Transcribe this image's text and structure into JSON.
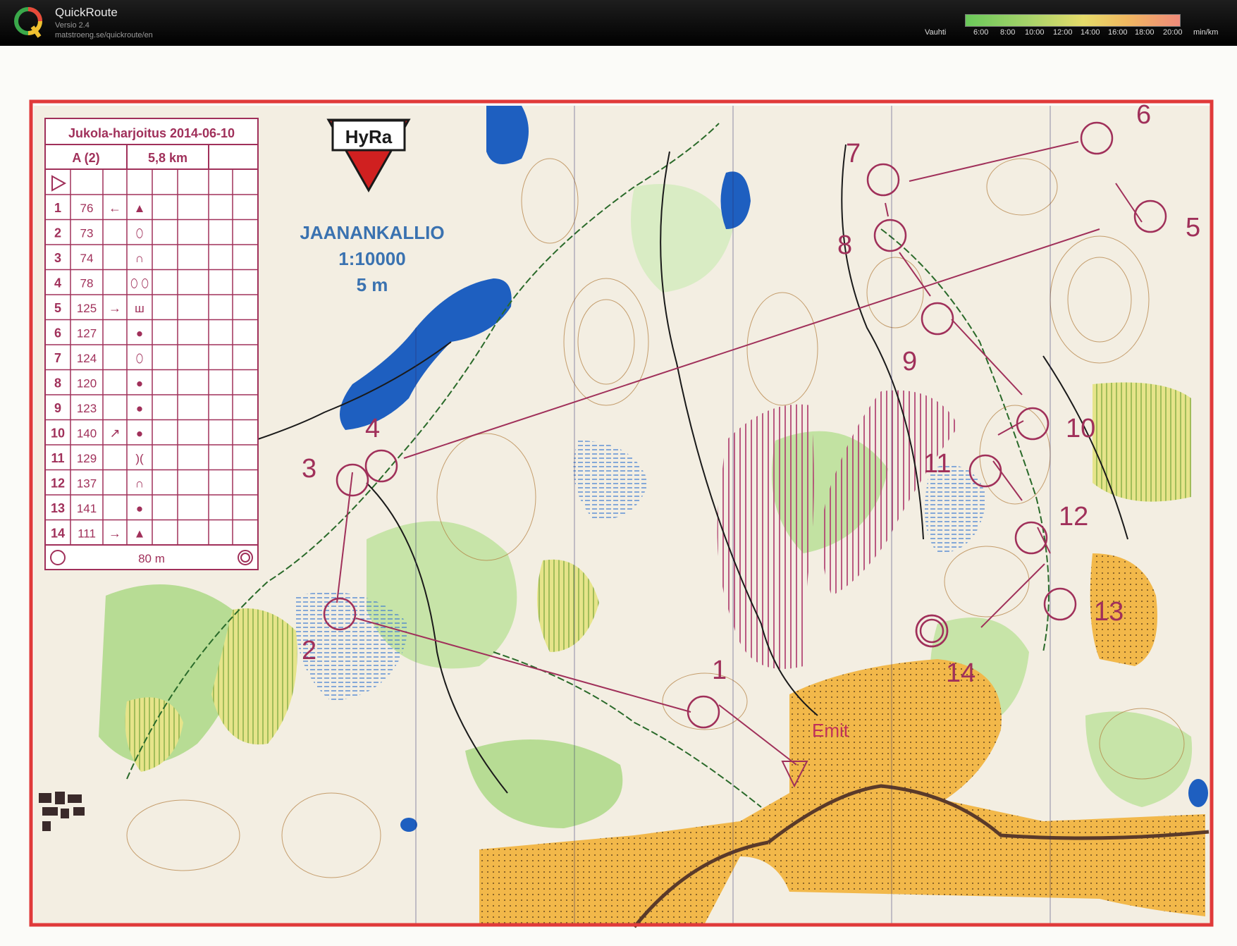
{
  "app": {
    "name": "QuickRoute",
    "version": "Versio 2.4",
    "url": "matstroeng.se/quickroute/en",
    "logo_letter": "Q"
  },
  "pace_scale": {
    "label": "Vauhti",
    "ticks": [
      "6:00",
      "8:00",
      "10:00",
      "12:00",
      "14:00",
      "16:00",
      "18:00",
      "20:00"
    ],
    "unit": "min/km"
  },
  "map": {
    "title": "JAANANKALLIO",
    "scale": "1:10000",
    "contour": "5 m",
    "club": "HyRa",
    "finish_label": "Emit",
    "colors": {
      "border": "#e03a3a",
      "course": "#a0305a",
      "water": "#1e5fc0",
      "open": "#f0b040",
      "green": "#9fd07a"
    }
  },
  "control_card": {
    "event": "Jukola-harjoitus 2014-06-10",
    "class": "A (2)",
    "length": "5,8 km",
    "rows": [
      {
        "num": "1",
        "code": "76",
        "dir": "←",
        "symbol": "▲"
      },
      {
        "num": "2",
        "code": "73",
        "dir": "",
        "symbol": "⬯"
      },
      {
        "num": "3",
        "code": "74",
        "dir": "",
        "symbol": "∩"
      },
      {
        "num": "4",
        "code": "78",
        "dir": "",
        "symbol": "⬯ ⬯"
      },
      {
        "num": "5",
        "code": "125",
        "dir": "→",
        "symbol": "ш"
      },
      {
        "num": "6",
        "code": "127",
        "dir": "",
        "symbol": "●"
      },
      {
        "num": "7",
        "code": "124",
        "dir": "",
        "symbol": "⬯"
      },
      {
        "num": "8",
        "code": "120",
        "dir": "",
        "symbol": "●"
      },
      {
        "num": "9",
        "code": "123",
        "dir": "",
        "symbol": "●"
      },
      {
        "num": "10",
        "code": "140",
        "dir": "↗",
        "symbol": "●"
      },
      {
        "num": "11",
        "code": "129",
        "dir": "",
        "symbol": ")("
      },
      {
        "num": "12",
        "code": "137",
        "dir": "",
        "symbol": "∩"
      },
      {
        "num": "13",
        "code": "141",
        "dir": "",
        "symbol": "●"
      },
      {
        "num": "14",
        "code": "111",
        "dir": "→",
        "symbol": "▲"
      }
    ],
    "finish_distance": "80 m"
  },
  "controls": [
    {
      "label": "1"
    },
    {
      "label": "2"
    },
    {
      "label": "3"
    },
    {
      "label": "4"
    },
    {
      "label": "5"
    },
    {
      "label": "6"
    },
    {
      "label": "7"
    },
    {
      "label": "8"
    },
    {
      "label": "9"
    },
    {
      "label": "10"
    },
    {
      "label": "11"
    },
    {
      "label": "12"
    },
    {
      "label": "13"
    },
    {
      "label": "14"
    }
  ]
}
